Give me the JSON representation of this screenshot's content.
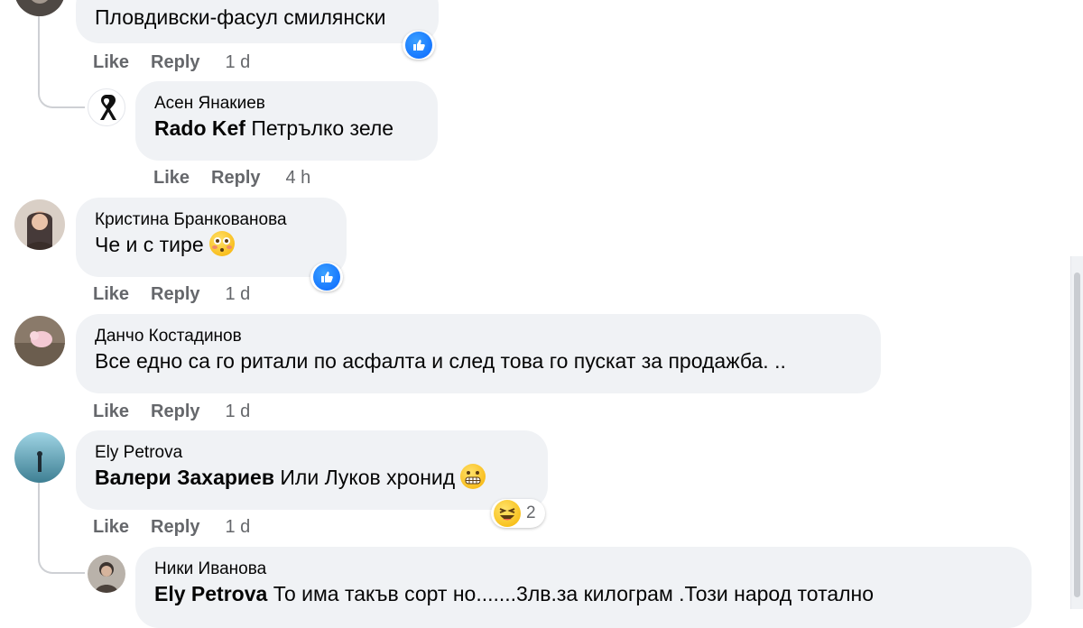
{
  "actions": {
    "like": "Like",
    "reply": "Reply"
  },
  "comments": [
    {
      "author": "",
      "text": "Пловдивски-фасул смилянски",
      "time": "1 d",
      "reaction": "like"
    },
    {
      "author": "Асен Янакиев",
      "tag": "Rado Kef",
      "text": "Петрълко зеле",
      "time": "4 h"
    },
    {
      "author": "Кристина Бранкованова",
      "text": "Че и с тире",
      "time": "1 d",
      "reaction": "like",
      "emoji": "flushed-face"
    },
    {
      "author": "Данчо Костадинов",
      "text": "Все едно са го ритали по асфалта и след това го пускат за продажба. ..",
      "time": "1 d"
    },
    {
      "author": "Ely Petrova",
      "tag": "Валери Захариев",
      "text": "Или Луков хронид",
      "time": "1 d",
      "reaction": "haha",
      "reaction_count": "2",
      "emoji": "grimacing-face"
    },
    {
      "author": "Ники Иванова",
      "tag": "Ely Petrova",
      "text": "То има такъв сорт но.......3лв.за килограм .Този народ тотално"
    }
  ],
  "colors": {
    "bubble": "#f0f2f5",
    "like_blue": "#0866ff",
    "meta": "#65676b"
  }
}
